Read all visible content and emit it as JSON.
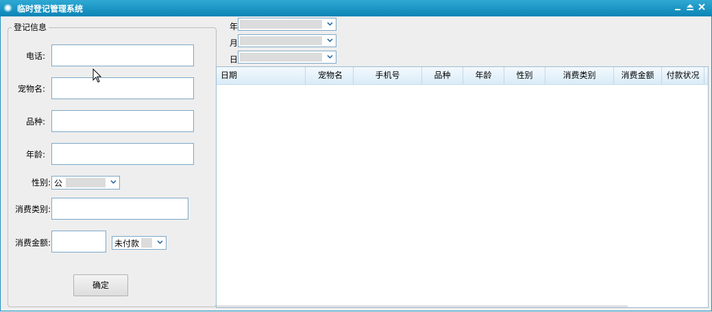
{
  "window": {
    "title": "临时登记管理系统"
  },
  "form": {
    "group_title": "登记信息",
    "phone_label": "电话:",
    "pet_name_label": "宠物名:",
    "breed_label": "品种:",
    "age_label": "年龄:",
    "gender_label": "性别:",
    "gender_value": "公",
    "category_label": "消费类别:",
    "amount_label": "消费金额:",
    "payment_status_value": "未付款",
    "confirm_label": "确定"
  },
  "filters": {
    "year_label": "年",
    "month_label": "月",
    "day_label": "日"
  },
  "table": {
    "columns": [
      "日期",
      "宠物名",
      "手机号",
      "品种",
      "年龄",
      "性别",
      "消费类别",
      "消费金额",
      "付款状况"
    ]
  }
}
